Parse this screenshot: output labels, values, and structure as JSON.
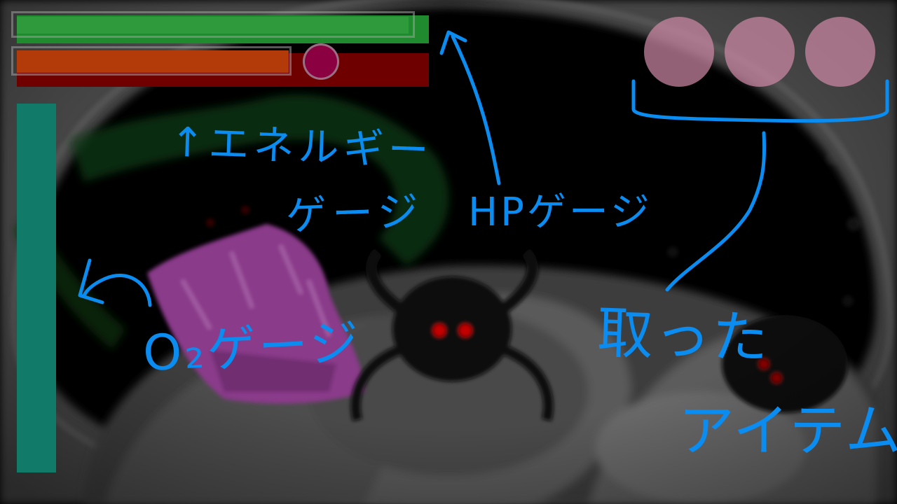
{
  "scene": {
    "description_icon": "spider-creature-scene",
    "palette": {
      "dark_bg": "#000000",
      "ground": "#6e6e6e",
      "crystal": "#8a3a8a",
      "eye": "#c40000"
    }
  },
  "hud": {
    "hp_gauge": {
      "level": 0.95,
      "color": "#2e9a3c",
      "icon": "hp-bar"
    },
    "energy_gauge": {
      "level": 0.66,
      "color": "#b33b0a",
      "track_color": "#6e0000",
      "knob_color": "#8a0040"
    },
    "o2_gauge": {
      "level": 1.0,
      "color": "#117a68"
    },
    "item_slots": [
      {
        "color": "#d08aa6"
      },
      {
        "color": "#d08aa6"
      },
      {
        "color": "#d08aa6"
      }
    ]
  },
  "annotations": {
    "energy_line1": "↑エネルギー",
    "energy_line2": "ゲージ",
    "hp": "HPゲージ",
    "o2": "O₂ゲージ",
    "item_line1": "取った",
    "item_line2": "アイテム",
    "color": "#0a8cf0"
  }
}
